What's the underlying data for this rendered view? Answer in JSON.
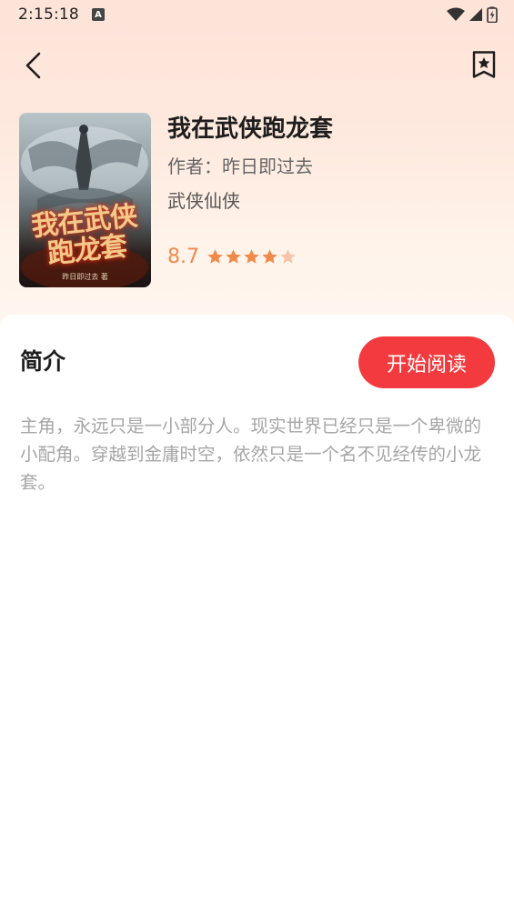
{
  "status_bar": {
    "time": "2:15:18",
    "notification_letter": "A",
    "icons": [
      "wifi-icon",
      "signal-icon",
      "battery-icon"
    ]
  },
  "nav": {
    "back_icon": "chevron-left-icon",
    "bookmark_icon": "bookmark-star-icon"
  },
  "book": {
    "cover_title": "我在武侠跑龙套",
    "cover_author": "昨日即过去 著",
    "title": "我在武侠跑龙套",
    "author": "作者：昨日即过去",
    "category": "武侠仙侠",
    "rating": "8.7",
    "rating_value": 8.7,
    "rating_max": 10,
    "stars_full": 4,
    "stars_total": 5
  },
  "intro": {
    "heading": "简介",
    "read_button": "开始阅读",
    "text": "主角，永远只是一小部分人。现实世界已经只是一个卑微的小配角。穿越到金庸时空，依然只是一个名不见经传的小龙套。"
  },
  "colors": {
    "accent_red": "#f33a3e",
    "rating_orange": "#f08a4b",
    "star_faded": "#f7c4a8"
  }
}
